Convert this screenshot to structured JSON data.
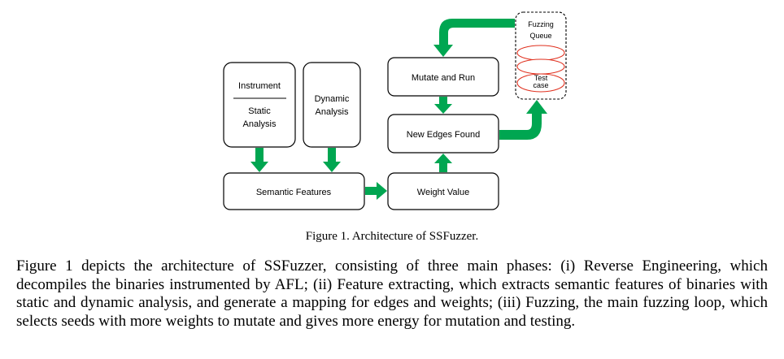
{
  "diagram": {
    "instrument": "Instrument",
    "static_line1": "Static",
    "static_line2": "Analysis",
    "dynamic_line1": "Dynamic",
    "dynamic_line2": "Analysis",
    "semantic_features": "Semantic Features",
    "weight_value": "Weight Value",
    "new_edges_found": "New Edges Found",
    "mutate_and_run": "Mutate and Run",
    "fuzzing_queue_line1": "Fuzzing",
    "fuzzing_queue_line2": "Queue",
    "test_case_line1": "Test",
    "test_case_line2": "case",
    "arrow_color": "#00a651"
  },
  "caption": "Figure 1. Architecture of SSFuzzer.",
  "paragraph": "Figure 1 depicts the architecture of SSFuzzer, consisting of three main phases: (i) Reverse Engineering, which decompiles the binaries instrumented by AFL; (ii) Feature extracting, which extracts semantic features of binaries with static and dynamic analysis, and generate a mapping for edges and weights; (iii) Fuzzing, the main fuzzing loop, which selects seeds with more weights to mutate and gives more energy for mutation and testing."
}
